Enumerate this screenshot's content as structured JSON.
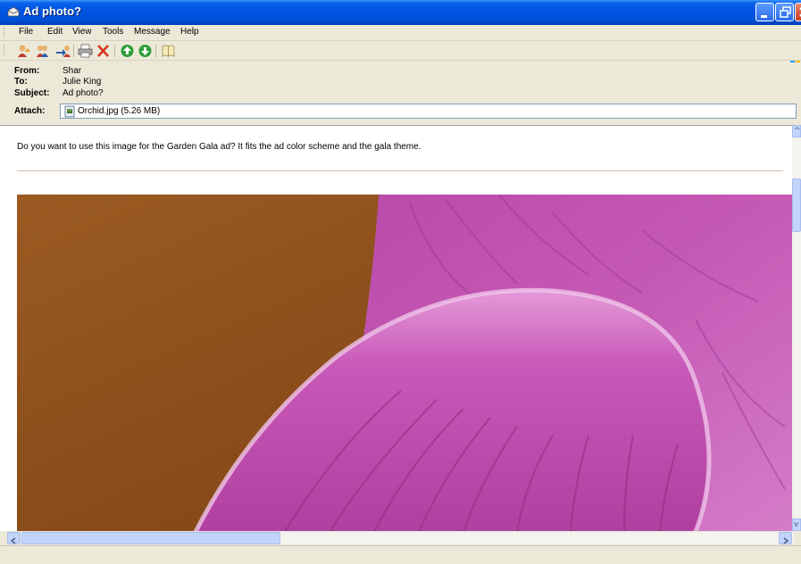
{
  "window": {
    "title": "Ad photo?"
  },
  "menu": {
    "items": [
      {
        "label": "File"
      },
      {
        "label": "Edit"
      },
      {
        "label": "View"
      },
      {
        "label": "Tools"
      },
      {
        "label": "Message"
      },
      {
        "label": "Help"
      }
    ]
  },
  "toolbar": {
    "icons": [
      "reply-icon",
      "reply-all-icon",
      "forward-icon",
      "print-icon",
      "delete-icon",
      "previous-icon",
      "next-icon",
      "address-book-icon"
    ]
  },
  "header": {
    "from_label": "From:",
    "from_value": "Shar",
    "to_label": "To:",
    "to_value": "Julie King",
    "subject_label": "Subject:",
    "subject_value": "Ad photo?",
    "attach_label": "Attach:",
    "attach_value": "Orchid.jpg (5.26 MB)"
  },
  "message": {
    "body": "Do you want to use this image for the Garden Gala ad? It fits the ad color scheme and the gala theme."
  },
  "colors": {
    "titlebar": "#0054e3",
    "photo_background": "#8a4f1c",
    "petal": "#c04fb4"
  }
}
